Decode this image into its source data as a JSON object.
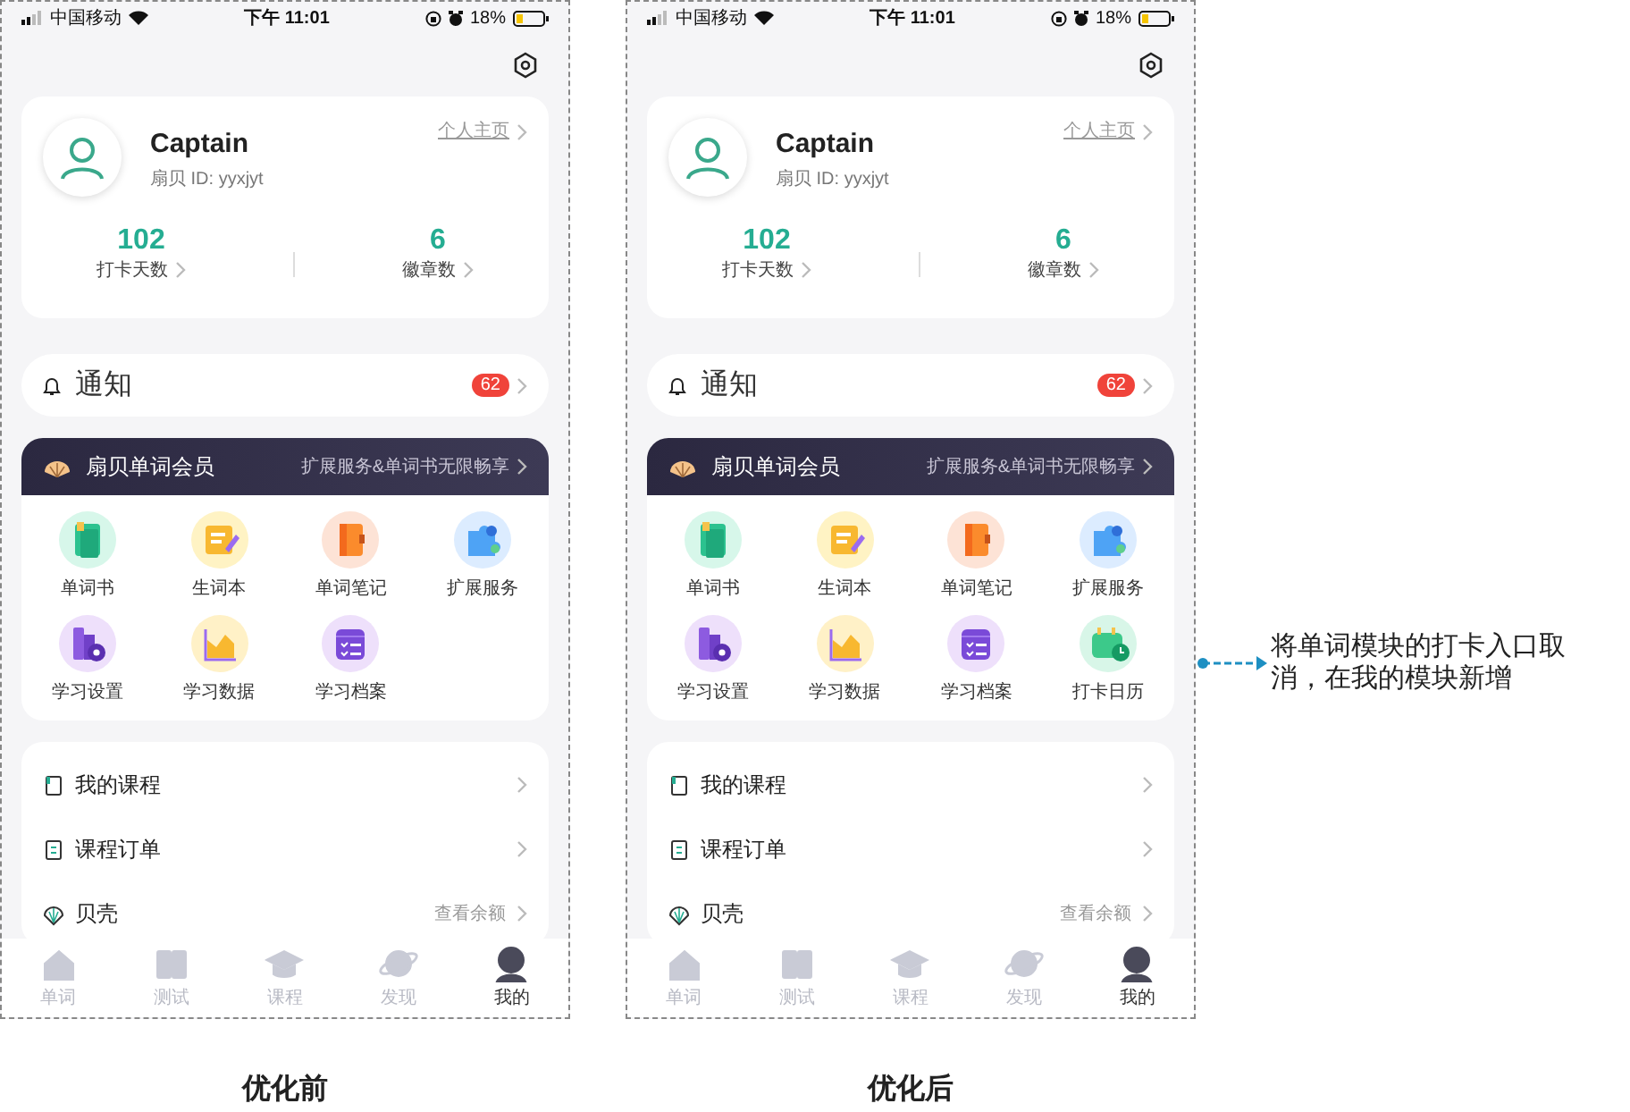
{
  "screens": [
    {
      "caption": "优化前",
      "status_bar": {
        "carrier": "中国移动",
        "time": "下午 11:01",
        "battery": "18%"
      },
      "profile": {
        "name": "Captain",
        "user_id": "扇贝 ID: yyxjyt",
        "link": "个人主页"
      },
      "stats": [
        {
          "value": "102",
          "label": "打卡天数"
        },
        {
          "value": "6",
          "label": "徽章数"
        }
      ],
      "notice": {
        "label": "通知",
        "badge": "62"
      },
      "vip": {
        "title": "扇贝单词会员",
        "subtitle": "扩展服务&单词书无限畅享"
      },
      "tools": [
        {
          "kind": "book",
          "label": "单词书"
        },
        {
          "kind": "notepad",
          "label": "生词本"
        },
        {
          "kind": "notebook",
          "label": "单词笔记"
        },
        {
          "kind": "puzzle",
          "label": "扩展服务"
        },
        {
          "kind": "settings",
          "label": "学习设置"
        },
        {
          "kind": "chart",
          "label": "学习数据"
        },
        {
          "kind": "archive",
          "label": "学习档案"
        }
      ],
      "menu": [
        {
          "kind": "course",
          "label": "我的课程"
        },
        {
          "kind": "order",
          "label": "课程订单"
        },
        {
          "kind": "shell",
          "label": "贝壳",
          "detail": "查看余额"
        }
      ],
      "tabs": [
        {
          "kind": "home",
          "label": "单词",
          "selected": false
        },
        {
          "kind": "book",
          "label": "测试",
          "selected": false
        },
        {
          "kind": "cap",
          "label": "课程",
          "selected": false
        },
        {
          "kind": "planet",
          "label": "发现",
          "selected": false
        },
        {
          "kind": "me",
          "label": "我的",
          "selected": true
        }
      ]
    },
    {
      "caption": "优化后",
      "status_bar": {
        "carrier": "中国移动",
        "time": "下午 11:01",
        "battery": "18%"
      },
      "profile": {
        "name": "Captain",
        "user_id": "扇贝 ID: yyxjyt",
        "link": "个人主页"
      },
      "stats": [
        {
          "value": "102",
          "label": "打卡天数"
        },
        {
          "value": "6",
          "label": "徽章数"
        }
      ],
      "notice": {
        "label": "通知",
        "badge": "62"
      },
      "vip": {
        "title": "扇贝单词会员",
        "subtitle": "扩展服务&单词书无限畅享"
      },
      "tools": [
        {
          "kind": "book",
          "label": "单词书"
        },
        {
          "kind": "notepad",
          "label": "生词本"
        },
        {
          "kind": "notebook",
          "label": "单词笔记"
        },
        {
          "kind": "puzzle",
          "label": "扩展服务"
        },
        {
          "kind": "settings",
          "label": "学习设置"
        },
        {
          "kind": "chart",
          "label": "学习数据"
        },
        {
          "kind": "archive",
          "label": "学习档案"
        },
        {
          "kind": "calendar",
          "label": "打卡日历"
        }
      ],
      "menu": [
        {
          "kind": "course",
          "label": "我的课程"
        },
        {
          "kind": "order",
          "label": "课程订单"
        },
        {
          "kind": "shell",
          "label": "贝壳",
          "detail": "查看余额"
        }
      ],
      "tabs": [
        {
          "kind": "home",
          "label": "单词",
          "selected": false
        },
        {
          "kind": "book",
          "label": "测试",
          "selected": false
        },
        {
          "kind": "cap",
          "label": "课程",
          "selected": false
        },
        {
          "kind": "planet",
          "label": "发现",
          "selected": false
        },
        {
          "kind": "me",
          "label": "我的",
          "selected": true
        }
      ]
    }
  ],
  "annotation": {
    "text": "将单词模块的打卡入口取消，在我的模块新增"
  }
}
